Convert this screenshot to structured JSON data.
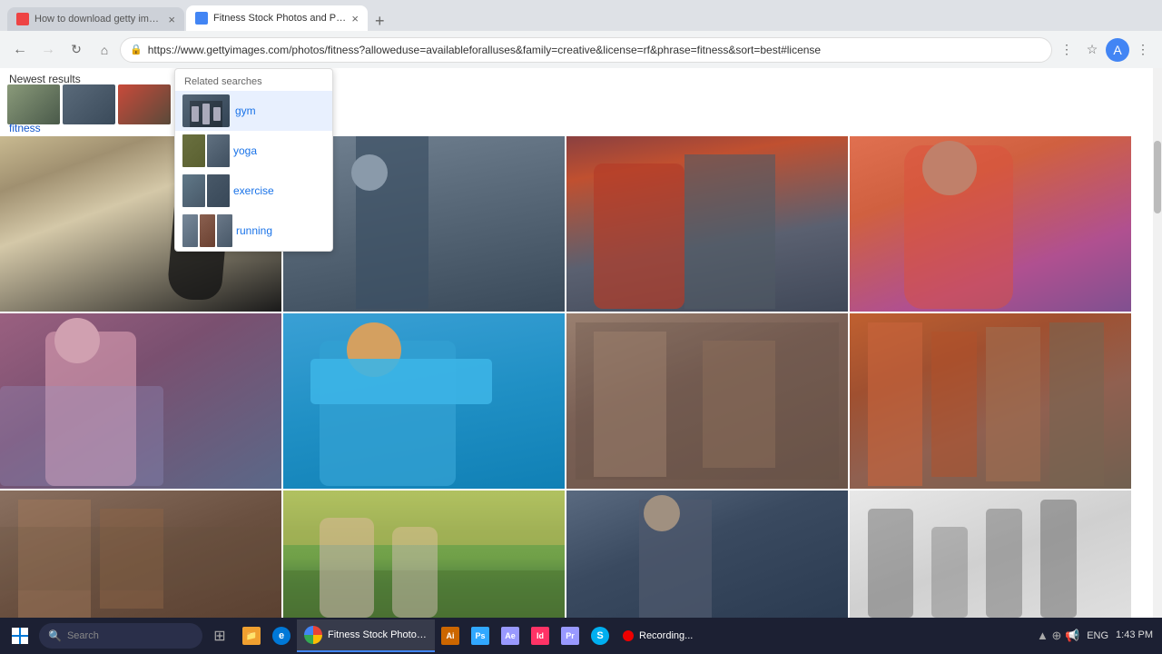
{
  "browser": {
    "tabs": [
      {
        "id": "tab1",
        "label": "How to download getty imag...",
        "favicon_color": "#e44",
        "active": false
      },
      {
        "id": "tab2",
        "label": "Fitness Stock Photos and Pict...",
        "favicon_color": "#4285f4",
        "active": true
      }
    ],
    "url": "https://www.gettyimages.com/photos/fitness?alloweduse=availableforalluses&family=creative&license=rf&phrase=fitness&sort=best#license",
    "new_tab_label": "+"
  },
  "page": {
    "newest_results_label": "Newest results",
    "related_header": "Related searches",
    "related_items": [
      {
        "id": "gym",
        "label": "gym",
        "color": "#556"
      },
      {
        "id": "yoga",
        "label": "yoga",
        "color": "#667"
      },
      {
        "id": "exercise",
        "label": "exercise",
        "color": "#778"
      },
      {
        "id": "running",
        "label": "running",
        "color": "#889"
      }
    ]
  },
  "taskbar": {
    "items": [
      {
        "id": "file-explorer",
        "label": "",
        "color": "#f0a030"
      },
      {
        "id": "edge",
        "label": "",
        "color": "#0078d7"
      },
      {
        "id": "chrome",
        "label": "Fitness Stock Photos...",
        "color": "#4285f4"
      },
      {
        "id": "ai",
        "label": "",
        "color": "#cc6600"
      },
      {
        "id": "ps",
        "label": "",
        "color": "#31a8ff"
      },
      {
        "id": "ae",
        "label": "",
        "color": "#9999ff"
      },
      {
        "id": "id",
        "label": "",
        "color": "#ff3366"
      },
      {
        "id": "pr",
        "label": "",
        "color": "#9999ff"
      },
      {
        "id": "skype",
        "label": "",
        "color": "#00aff0"
      },
      {
        "id": "recording",
        "label": "Recording...",
        "color": "#e00"
      }
    ],
    "system_tray": {
      "lang": "ENG",
      "time": "1:43 PM"
    }
  }
}
